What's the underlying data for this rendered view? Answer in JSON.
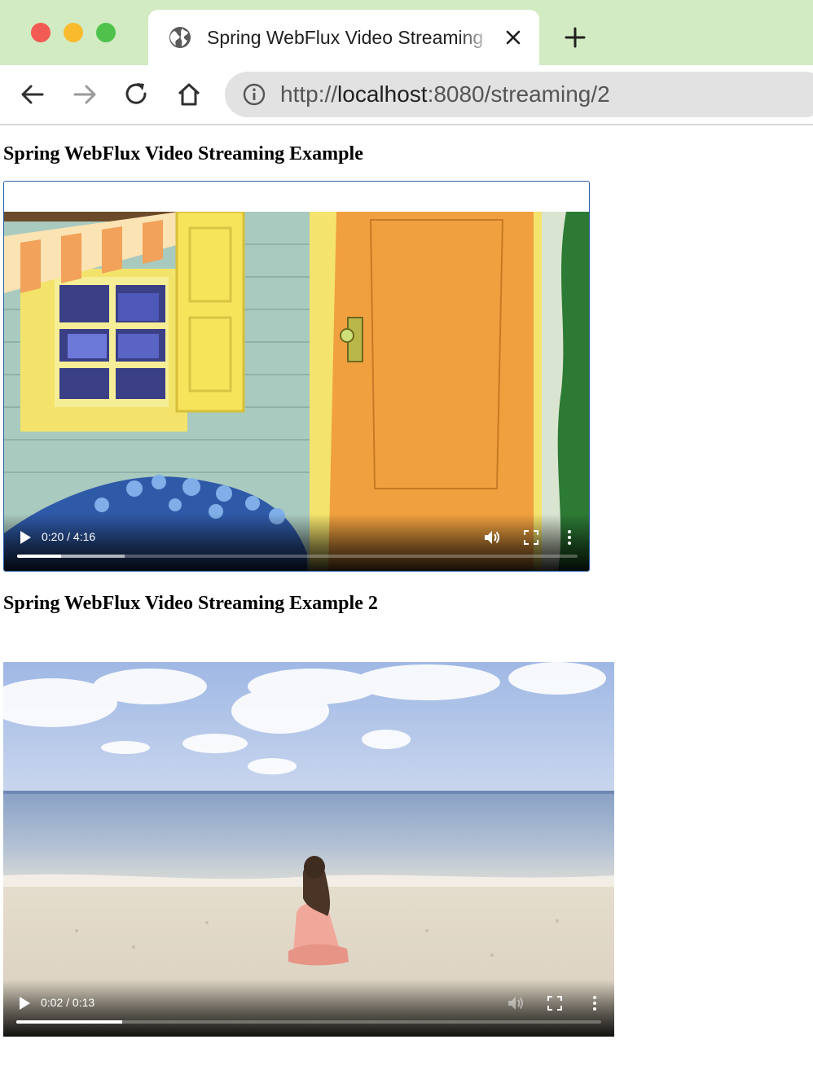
{
  "browser": {
    "tab": {
      "title": "Spring WebFlux Video Streaming",
      "favicon": "globe-icon"
    },
    "address_bar": {
      "url_scheme": "http://",
      "url_host": "localhost",
      "url_rest": ":8080/streaming/2"
    }
  },
  "page": {
    "heading_1": "Spring WebFlux Video Streaming Example",
    "heading_2": "Spring WebFlux Video Streaming Example 2"
  },
  "videos": [
    {
      "time": "0:20 / 4:16",
      "played_fraction": 0.078,
      "buffered_fraction": 0.192,
      "muted": false
    },
    {
      "time": "0:02 / 0:13",
      "played_fraction": 0.181,
      "buffered_fraction": 0.181,
      "muted": true
    }
  ],
  "colors": {
    "tab_strip": "#d3ebc3",
    "focus_outline": "#2b5fab"
  }
}
